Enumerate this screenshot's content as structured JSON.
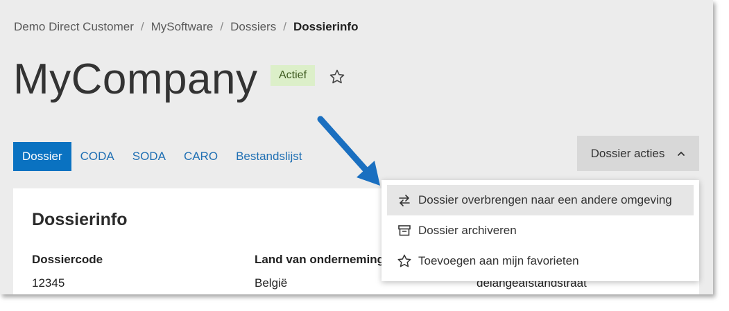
{
  "breadcrumb": {
    "items": [
      "Demo Direct Customer",
      "MySoftware",
      "Dossiers"
    ],
    "current": "Dossierinfo",
    "separator": "/"
  },
  "header": {
    "title": "MyCompany",
    "status_badge": "Actief",
    "favorite_icon": "star-outline-icon"
  },
  "tabs": [
    {
      "label": "Dossier",
      "active": true
    },
    {
      "label": "CODA",
      "active": false
    },
    {
      "label": "SODA",
      "active": false
    },
    {
      "label": "CARO",
      "active": false
    },
    {
      "label": "Bestandslijst",
      "active": false
    }
  ],
  "actions": {
    "label": "Dossier acties",
    "icon": "chevron-up-icon",
    "menu": [
      {
        "label": "Dossier overbrengen naar een andere omgeving",
        "icon": "transfer-arrows-icon",
        "highlighted": true
      },
      {
        "label": "Dossier archiveren",
        "icon": "archive-box-icon",
        "highlighted": false
      },
      {
        "label": "Toevoegen aan mijn favorieten",
        "icon": "star-outline-icon",
        "highlighted": false
      }
    ]
  },
  "card": {
    "title": "Dossierinfo",
    "fields": [
      {
        "label": "Dossiercode",
        "value": "12345"
      },
      {
        "label": "Land van onderneming",
        "value": "België"
      },
      {
        "label": "",
        "value": "delangeafstandstraat"
      }
    ]
  },
  "colors": {
    "accent": "#0a72c1",
    "badge_bg": "#dcefc9",
    "page_bg": "#ececec",
    "annotation_arrow": "#1a6fc0"
  }
}
